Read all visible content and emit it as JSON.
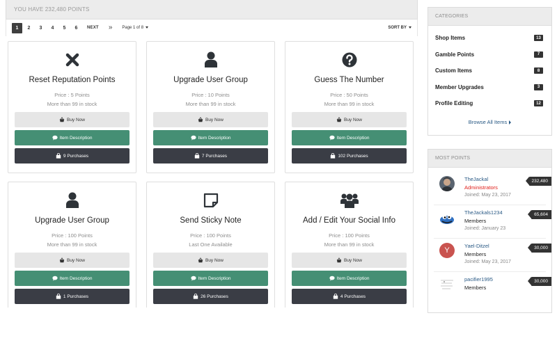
{
  "header": {
    "points_text": "YOU HAVE 232,480 POINTS"
  },
  "pagination": {
    "pages": [
      "1",
      "2",
      "3",
      "4",
      "5",
      "6"
    ],
    "active": "1",
    "next": "NEXT",
    "last_icon": "double-chevron-right-icon",
    "page_of": "Page 1 of 8",
    "sort_by": "SORT BY"
  },
  "items": [
    {
      "title": "Reset Reputation Points",
      "icon": "close-icon",
      "price": "Price : 5 Points",
      "stock": "More than 99 in stock",
      "buy": "Buy Now",
      "desc": "Item Description",
      "purchases": "9 Purchases"
    },
    {
      "title": "Upgrade User Group",
      "icon": "user-icon",
      "price": "Price : 10 Points",
      "stock": "More than 99 in stock",
      "buy": "Buy Now",
      "desc": "Item Description",
      "purchases": "7 Purchases"
    },
    {
      "title": "Guess The Number",
      "icon": "question-icon",
      "price": "Price : 50 Points",
      "stock": "More than 99 in stock",
      "buy": "Buy Now",
      "desc": "Item Description",
      "purchases": "102 Purchases"
    },
    {
      "title": "Upgrade User Group",
      "icon": "user-icon",
      "price": "Price : 100 Points",
      "stock": "More than 99 in stock",
      "buy": "Buy Now",
      "desc": "Item Description",
      "purchases": "1 Purchases"
    },
    {
      "title": "Send Sticky Note",
      "icon": "sticky-note-icon",
      "price": "Price : 100 Points",
      "stock": "Last One Available",
      "buy": "Buy Now",
      "desc": "Item Description",
      "purchases": "26 Purchases"
    },
    {
      "title": "Add / Edit Your Social Info",
      "icon": "users-icon",
      "price": "Price : 100 Points",
      "stock": "More than 99 in stock",
      "buy": "Buy Now",
      "desc": "Item Description",
      "purchases": "4 Purchases"
    }
  ],
  "categories": {
    "heading": "CATEGORIES",
    "items": [
      {
        "label": "Shop Items",
        "count": "13"
      },
      {
        "label": "Gamble Points",
        "count": "7"
      },
      {
        "label": "Custom Items",
        "count": "8"
      },
      {
        "label": "Member Upgrades",
        "count": "3"
      },
      {
        "label": "Profile Editing",
        "count": "12"
      }
    ],
    "browse_all": "Browse All Items"
  },
  "most_points": {
    "heading": "MOST POINTS",
    "members": [
      {
        "name": "TheJackal",
        "role": "Administrators",
        "joined": "Joined: May 23, 2017",
        "points": "232,480",
        "avatar": "photo-avatar-icon"
      },
      {
        "name": "TheJackals1234",
        "role": "Members",
        "joined": "Joined: January 23",
        "points": "65,604",
        "avatar": "cookie-monster-avatar-icon"
      },
      {
        "name": "Yael-Ditzel",
        "role": "Members",
        "joined": "Joined: May 23, 2017",
        "points": "30,000",
        "avatar": "letter-avatar-icon",
        "avatar_letter": "Y"
      },
      {
        "name": "pacifier1995",
        "role": "Members",
        "joined": "",
        "points": "30,000",
        "avatar": "sketch-avatar-icon"
      }
    ]
  },
  "colors": {
    "green_button": "#458f74",
    "dark_button": "#3a3d45",
    "light_button": "#e6e6e6",
    "admin_role": "#e0201b",
    "link": "#2a5a85",
    "letter_avatar": "#c9534f"
  }
}
